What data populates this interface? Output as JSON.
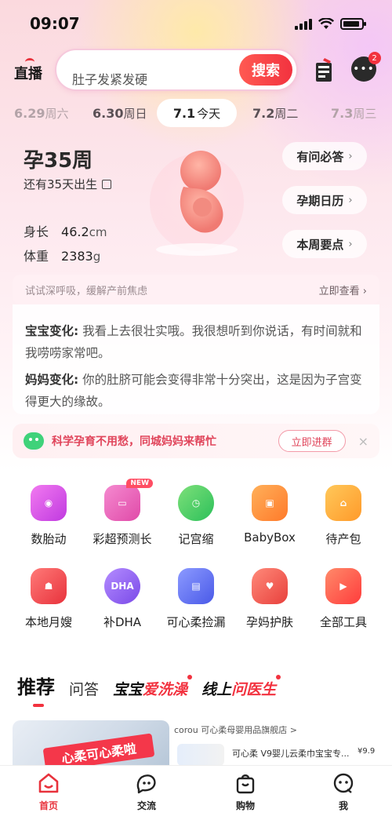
{
  "status_bar": {
    "time": "09:07"
  },
  "header": {
    "live_label": "直播",
    "search_placeholder": "肚子发紧发硬",
    "search_button": "搜索",
    "message_badge": "2"
  },
  "dates": [
    {
      "date": "6.29",
      "weekday": "周六"
    },
    {
      "date": "6.30",
      "weekday": "周日"
    },
    {
      "date": "7.1",
      "weekday": "今天",
      "selected": true
    },
    {
      "date": "7.2",
      "weekday": "周二"
    },
    {
      "date": "7.3",
      "weekday": "周三"
    }
  ],
  "pregnancy": {
    "week": "孕35周",
    "due_text": "还有35天出生",
    "height_label": "身长",
    "height_value": "46.2",
    "height_unit": "cm",
    "weight_label": "体重",
    "weight_value": "2383",
    "weight_unit": "g",
    "side_buttons": [
      "有问必答",
      "孕期日历",
      "本周要点"
    ]
  },
  "tip": {
    "text": "试试深呼吸，缓解产前焦虑",
    "link": "立即查看"
  },
  "changes": {
    "baby_label": "宝宝变化:",
    "baby_text": " 我看上去很壮实哦。我很想听到你说话，有时间就和我唠唠家常吧。",
    "mom_label": "妈妈变化:",
    "mom_text": " 你的肚脐可能会变得非常十分突出，这是因为子宫变得更大的缘故。"
  },
  "promo": {
    "text": "科学孕育不用愁，同城妈妈来帮忙",
    "button": "立即进群",
    "close": "×"
  },
  "tools": [
    {
      "label": "数胎动",
      "icon": "fetal-movement-icon",
      "color": "#d24cf0"
    },
    {
      "label": "彩超预测长",
      "icon": "ultrasound-icon",
      "color": "#e95fb6",
      "badge": "NEW"
    },
    {
      "label": "记宫缩",
      "icon": "contraction-timer-icon",
      "color": "#3fcf6a"
    },
    {
      "label": "BabyBox",
      "icon": "babybox-icon",
      "color": "#ff8a3d"
    },
    {
      "label": "待产包",
      "icon": "delivery-bag-icon",
      "color": "#ffa33a"
    },
    {
      "label": "本地月嫂",
      "icon": "nanny-icon",
      "color": "#f1474f"
    },
    {
      "label": "补DHA",
      "icon": "dha-icon",
      "color": "#8a5cf0",
      "icon_text": "DHA"
    },
    {
      "label": "可心柔捡漏",
      "icon": "deal-box-icon",
      "color": "#5b6cf0"
    },
    {
      "label": "孕妈护肤",
      "icon": "skincare-icon",
      "color": "#f35b5b"
    },
    {
      "label": "全部工具",
      "icon": "all-tools-icon",
      "color": "#ff5a4a"
    }
  ],
  "tabs": {
    "recommend": "推荐",
    "qa": "问答",
    "baby_wash_a": "宝宝",
    "baby_wash_b": "爱洗澡",
    "doctor_a": "线上",
    "doctor_b": "问医生"
  },
  "feed": {
    "sticker": "心柔可心柔啦",
    "shop_name": "corou 可心柔母婴用品旗舰店 >",
    "item": "可心柔 V9婴儿云柔巾宝宝专...",
    "price": "¥9.9"
  },
  "bottom_nav": [
    {
      "label": "首页",
      "icon": "home-icon",
      "active": true
    },
    {
      "label": "交流",
      "icon": "community-icon"
    },
    {
      "label": "购物",
      "icon": "shopping-bag-icon"
    },
    {
      "label": "我",
      "icon": "profile-icon"
    }
  ]
}
